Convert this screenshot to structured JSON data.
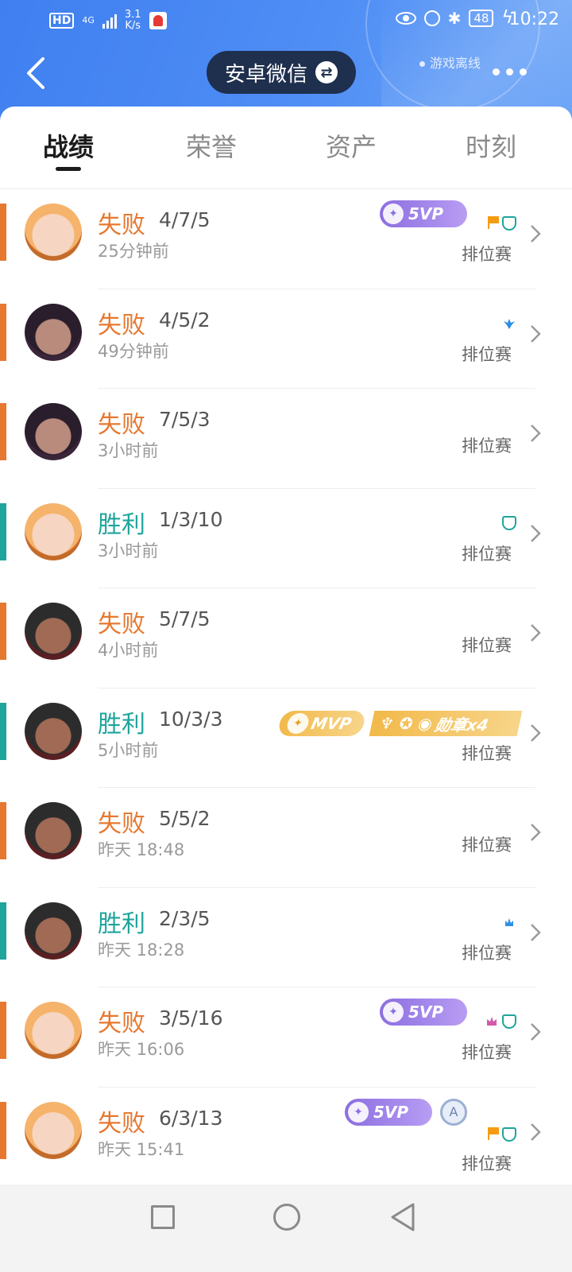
{
  "status_bar": {
    "hd": "HD",
    "network": "4G",
    "speed_value": "3.1",
    "speed_unit": "K/s",
    "battery": "48",
    "time": "10:22"
  },
  "header": {
    "switch_label": "安卓微信",
    "offline_label": "游戏离线"
  },
  "tabs": [
    {
      "label": "战绩",
      "active": true
    },
    {
      "label": "荣誉",
      "active": false
    },
    {
      "label": "资产",
      "active": false
    },
    {
      "label": "时刻",
      "active": false
    }
  ],
  "matches": [
    {
      "result": "失败",
      "kda": "4/7/5",
      "time": "25分钟前",
      "mode": "排位赛",
      "badge": "5VP"
    },
    {
      "result": "失败",
      "kda": "4/5/2",
      "time": "49分钟前",
      "mode": "排位赛"
    },
    {
      "result": "失败",
      "kda": "7/5/3",
      "time": "3小时前",
      "mode": "排位赛"
    },
    {
      "result": "胜利",
      "kda": "1/3/10",
      "time": "3小时前",
      "mode": "排位赛"
    },
    {
      "result": "失败",
      "kda": "5/7/5",
      "time": "4小时前",
      "mode": "排位赛"
    },
    {
      "result": "胜利",
      "kda": "10/3/3",
      "time": "5小时前",
      "mode": "排位赛",
      "badge": "MVP",
      "medal": "勋章x4"
    },
    {
      "result": "失败",
      "kda": "5/5/2",
      "time": "昨天 18:48",
      "mode": "排位赛"
    },
    {
      "result": "胜利",
      "kda": "2/3/5",
      "time": "昨天 18:28",
      "mode": "排位赛"
    },
    {
      "result": "失败",
      "kda": "3/5/16",
      "time": "昨天 16:06",
      "mode": "排位赛",
      "badge": "5VP"
    },
    {
      "result": "失败",
      "kda": "6/3/13",
      "time": "昨天 15:41",
      "mode": "排位赛",
      "badge": "5VP",
      "extra": "A"
    }
  ],
  "colors": {
    "lose": "#e7782f",
    "win": "#1fa59b",
    "header_blue": "#3f7ff0"
  }
}
